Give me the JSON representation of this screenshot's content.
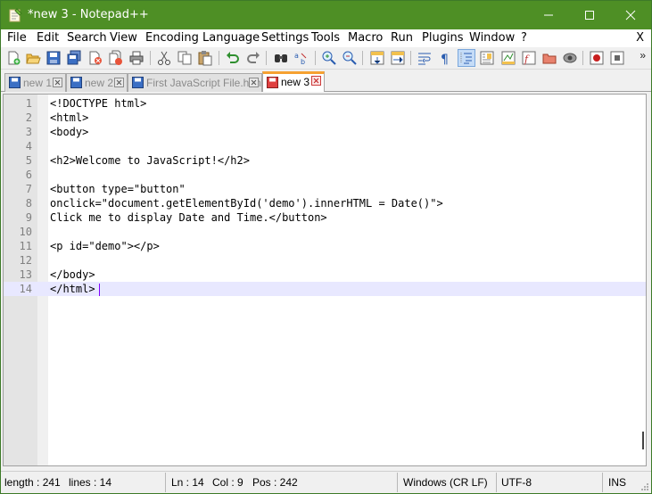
{
  "window": {
    "title": "*new 3 - Notepad++"
  },
  "menu": {
    "items": [
      "File",
      "Edit",
      "Search",
      "View",
      "Encoding",
      "Language",
      "Settings",
      "Tools",
      "Macro",
      "Run",
      "Plugins",
      "Window",
      "?"
    ],
    "close_label": "X"
  },
  "toolbar": {
    "more_label": "»"
  },
  "tabs": [
    {
      "label": "new 1",
      "active": false
    },
    {
      "label": "new 2",
      "active": false
    },
    {
      "label": "First JavaScript File.html",
      "active": false
    },
    {
      "label": "new 3",
      "active": true
    }
  ],
  "editor": {
    "current_line": 14,
    "lines": [
      {
        "n": "1",
        "text": "<!DOCTYPE html>"
      },
      {
        "n": "2",
        "text": "<html>"
      },
      {
        "n": "3",
        "text": "<body>"
      },
      {
        "n": "4",
        "text": ""
      },
      {
        "n": "5",
        "text": "<h2>Welcome to JavaScript!</h2>"
      },
      {
        "n": "6",
        "text": ""
      },
      {
        "n": "7",
        "text": "<button type=\"button\""
      },
      {
        "n": "8",
        "text": "onclick=\"document.getElementById('demo').innerHTML = Date()\">"
      },
      {
        "n": "9",
        "text": "Click me to display Date and Time.</button>"
      },
      {
        "n": "10",
        "text": ""
      },
      {
        "n": "11",
        "text": "<p id=\"demo\"></p>"
      },
      {
        "n": "12",
        "text": ""
      },
      {
        "n": "13",
        "text": "</body>"
      },
      {
        "n": "14",
        "text": "</html>"
      }
    ]
  },
  "status": {
    "length": "length : 241",
    "lines": "lines : 14",
    "ln": "Ln : 14",
    "col": "Col : 9",
    "pos": "Pos : 242",
    "eol": "Windows (CR LF)",
    "encoding": "UTF-8",
    "mode": "INS"
  },
  "colors": {
    "titlebar": "#4e8f25",
    "active_tab_accent": "#f6a131",
    "current_line": "#e8e8ff",
    "caret": "#8000ff"
  }
}
